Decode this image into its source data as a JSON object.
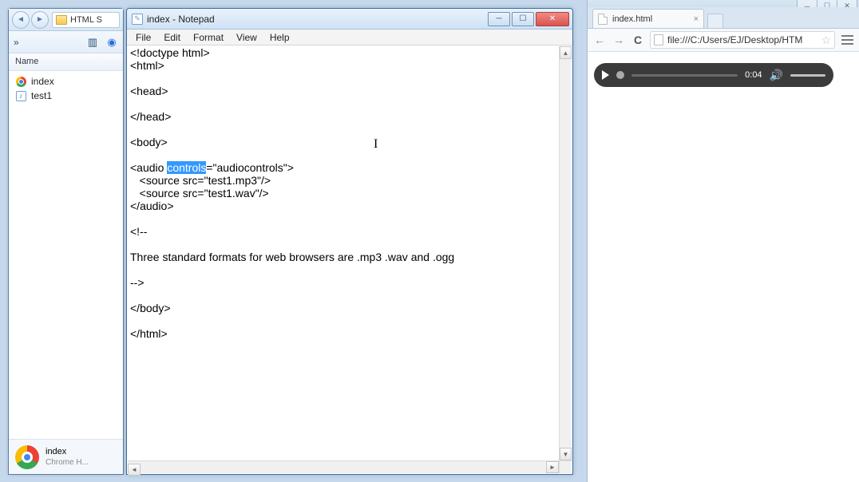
{
  "explorer": {
    "breadcrumb_label": "HTML S",
    "organize_label": "»",
    "column_header": "Name",
    "files": [
      {
        "name": "index",
        "icon": "chrome"
      },
      {
        "name": "test1",
        "icon": "music"
      }
    ],
    "task_name": "index",
    "task_sub": "Chrome H..."
  },
  "notepad": {
    "title": "index - Notepad",
    "menu": [
      "File",
      "Edit",
      "Format",
      "View",
      "Help"
    ],
    "code_before_sel": "<!doctype html>\n<html>\n\n<head>\n\n</head>\n\n<body>\n\n<audio ",
    "code_selected": "controls",
    "code_after_sel": "=\"audiocontrols\">\n   <source src=\"test1.mp3\"/>\n   <source src=\"test1.wav\"/>\n</audio>\n\n<!--\n\nThree standard formats for web browsers are .mp3 .wav and .ogg\n\n-->\n\n</body>\n\n</html>"
  },
  "chrome": {
    "tab_title": "index.html",
    "url": "file:///C:/Users/EJ/Desktop/HTM",
    "audio_time": "0:04"
  }
}
